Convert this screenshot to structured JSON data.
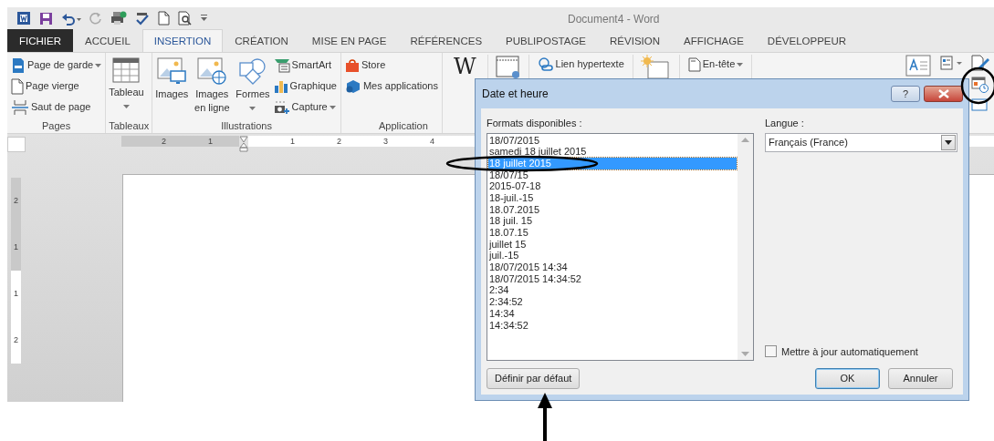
{
  "title_bar": {
    "title": "Document4 - Word"
  },
  "ribbon_tabs": [
    {
      "label": "FICHIER",
      "kind": "file",
      "selected": false
    },
    {
      "label": "ACCUEIL",
      "kind": "tab",
      "selected": false
    },
    {
      "label": "INSERTION",
      "kind": "tab",
      "selected": true
    },
    {
      "label": "CRÉATION",
      "kind": "tab",
      "selected": false
    },
    {
      "label": "MISE EN PAGE",
      "kind": "tab",
      "selected": false
    },
    {
      "label": "RÉFÉRENCES",
      "kind": "tab",
      "selected": false
    },
    {
      "label": "PUBLIPOSTAGE",
      "kind": "tab",
      "selected": false
    },
    {
      "label": "RÉVISION",
      "kind": "tab",
      "selected": false
    },
    {
      "label": "AFFICHAGE",
      "kind": "tab",
      "selected": false
    },
    {
      "label": "DÉVELOPPEUR",
      "kind": "tab",
      "selected": false
    }
  ],
  "ribbon_groups": [
    {
      "label": "Pages",
      "items": [
        {
          "label": "Page de garde",
          "kind": "small",
          "dropdown": true
        },
        {
          "label": "Page vierge",
          "kind": "small",
          "dropdown": false
        },
        {
          "label": "Saut de page",
          "kind": "small",
          "dropdown": false
        }
      ]
    },
    {
      "label": "Tableaux",
      "items": [
        {
          "label": "Tableau",
          "kind": "large",
          "dropdown": true
        }
      ]
    },
    {
      "label": "Illustrations",
      "items": [
        {
          "label": "Images",
          "kind": "large",
          "dropdown": false
        },
        {
          "label": "Images en ligne",
          "kind": "large",
          "dropdown": false
        },
        {
          "label": "Formes",
          "kind": "large",
          "dropdown": true
        },
        {
          "label": "SmartArt",
          "kind": "small",
          "dropdown": false
        },
        {
          "label": "Graphique",
          "kind": "small",
          "dropdown": false
        },
        {
          "label": "Capture",
          "kind": "small",
          "dropdown": true
        }
      ]
    },
    {
      "label": "Application",
      "items": [
        {
          "label": "Store",
          "kind": "small",
          "dropdown": false
        },
        {
          "label": "Mes applications",
          "kind": "small",
          "dropdown": false
        }
      ]
    }
  ],
  "ribbon_top_row": [
    {
      "label": "W",
      "kind": "logo"
    },
    {
      "label": "Lien hypertexte",
      "kind": "command",
      "dropdown": false
    },
    {
      "label": "En-tête",
      "kind": "command",
      "dropdown": true
    }
  ],
  "ruler": {
    "horizontal_labels": [
      "2",
      "1",
      "1",
      "2",
      "3",
      "4"
    ],
    "vertical_labels": [
      "2",
      "1",
      "1",
      "2"
    ]
  },
  "dialog": {
    "title": "Date et heure",
    "help": "?",
    "formats_label": "Formats disponibles :",
    "formats": [
      {
        "text": "18/07/2015",
        "selected": false
      },
      {
        "text": "samedi 18 juillet 2015",
        "selected": false
      },
      {
        "text": "18 juillet 2015",
        "selected": true
      },
      {
        "text": "18/07/15",
        "selected": false
      },
      {
        "text": "2015-07-18",
        "selected": false
      },
      {
        "text": "18-juil.-15",
        "selected": false
      },
      {
        "text": "18.07.2015",
        "selected": false
      },
      {
        "text": "18 juil. 15",
        "selected": false
      },
      {
        "text": "18.07.15",
        "selected": false
      },
      {
        "text": "juillet 15",
        "selected": false
      },
      {
        "text": "juil.-15",
        "selected": false
      },
      {
        "text": "18/07/2015 14:34",
        "selected": false
      },
      {
        "text": "18/07/2015 14:34:52",
        "selected": false
      },
      {
        "text": "2:34",
        "selected": false
      },
      {
        "text": "2:34:52",
        "selected": false
      },
      {
        "text": "14:34",
        "selected": false
      },
      {
        "text": "14:34:52",
        "selected": false
      }
    ],
    "language_label": "Langue :",
    "language": "Français (France)",
    "auto_update": {
      "label": "Mettre à jour automatiquement",
      "checked": false
    },
    "buttons": [
      {
        "label": "Définir par défaut",
        "kind": "left"
      },
      {
        "label": "OK",
        "kind": "default"
      },
      {
        "label": "Annuler",
        "kind": "normal"
      }
    ]
  }
}
